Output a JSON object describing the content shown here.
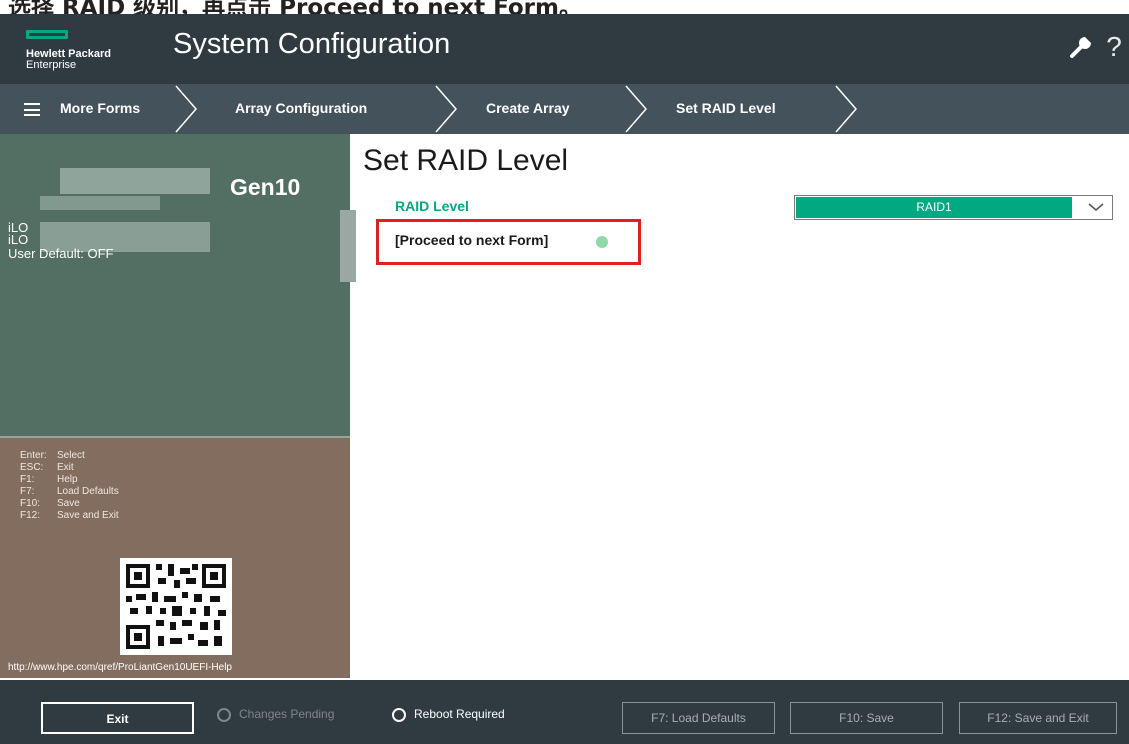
{
  "caption": {
    "text": "选择 RAID 级别，再点击 Proceed to next Form。"
  },
  "header": {
    "logo_line1": "Hewlett Packard",
    "logo_line2": "Enterprise",
    "title": "System Configuration",
    "help_label": "?",
    "icons": [
      "wrench-icon",
      "help-icon"
    ]
  },
  "breadcrumb": {
    "menu_label": "More Forms",
    "items": [
      "Array Configuration",
      "Create Array",
      "Set RAID Level"
    ]
  },
  "system_panel": {
    "model_suffix": "Gen10",
    "lines": [
      "iLO",
      "iLO",
      "User Default: OFF"
    ]
  },
  "keys": [
    {
      "key": "Enter:",
      "action": "Select"
    },
    {
      "key": "ESC:",
      "action": "Exit"
    },
    {
      "key": "F1:",
      "action": "Help"
    },
    {
      "key": "F7:",
      "action": "Load Defaults"
    },
    {
      "key": "F10:",
      "action": "Save"
    },
    {
      "key": "F12:",
      "action": "Save and Exit"
    }
  ],
  "help_url": "http://www.hpe.com/qref/ProLiantGen10UEFI-Help",
  "main": {
    "title": "Set RAID Level",
    "raid_label": "RAID Level",
    "raid_value": "RAID1",
    "proceed": "[Proceed to next Form]"
  },
  "footer": {
    "exit": "Exit",
    "changes_pending": "Changes Pending",
    "reboot_required": "Reboot Required",
    "load_defaults": "F7: Load Defaults",
    "save": "F10: Save",
    "save_exit": "F12: Save and Exit"
  },
  "colors": {
    "accent": "#01a982",
    "header_bg": "#303a41",
    "nav_bg": "#44525c",
    "info_panel": "#536e63",
    "keys_panel": "#826d5f",
    "highlight": "#e02020"
  }
}
